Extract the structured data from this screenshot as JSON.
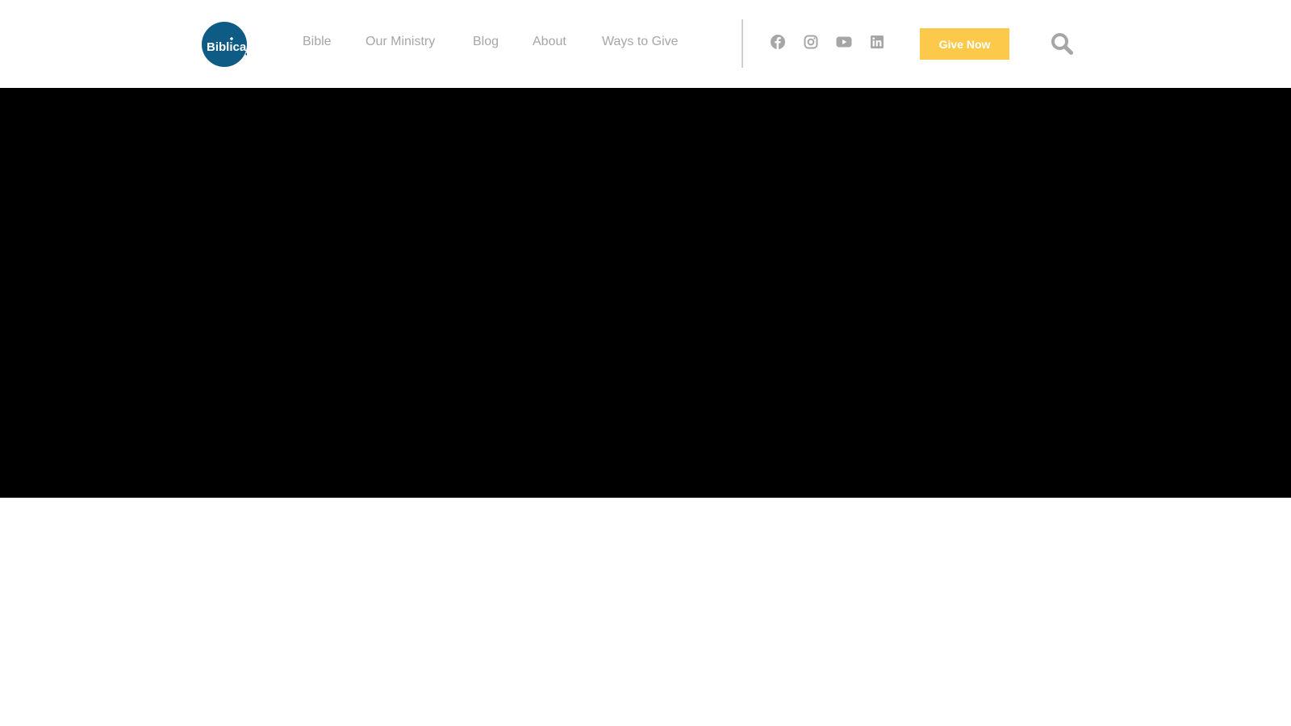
{
  "brand": {
    "logo_text": "Biblica",
    "logo_color": "#0e5b86"
  },
  "nav": {
    "items": [
      {
        "label": "Bible"
      },
      {
        "label": "Our Ministry"
      },
      {
        "label": "Blog"
      },
      {
        "label": "About"
      },
      {
        "label": "Ways to Give"
      }
    ],
    "text_color": "#a6a6a6"
  },
  "social": [
    {
      "icon": "facebook-icon"
    },
    {
      "icon": "instagram-icon"
    },
    {
      "icon": "youtube-icon"
    },
    {
      "icon": "linkedin-icon"
    }
  ],
  "cta": {
    "label": "Give Now",
    "color": "#fdc94b"
  },
  "search": {
    "icon": "search-icon"
  },
  "hero": {
    "background": "#000000"
  }
}
